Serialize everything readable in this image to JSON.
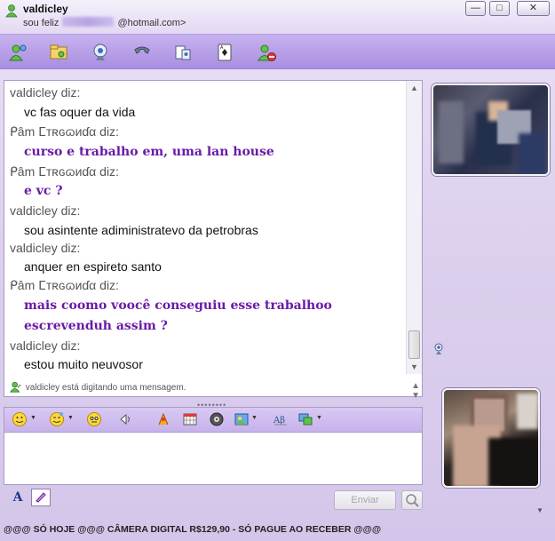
{
  "window": {
    "contact_name": "valdicley",
    "status_prefix": "sou feliz",
    "status_suffix": "@hotmail.com>",
    "minimize": "—",
    "maximize": "□",
    "close": "✕"
  },
  "toolbar": {
    "icons": [
      "invite-contact-icon",
      "send-files-icon",
      "webcam-icon",
      "call-icon",
      "video-call-icon",
      "games-icon",
      "block-icon"
    ]
  },
  "conversation": [
    {
      "sender": "valdicley diz:",
      "text": "vc fas oquer da vida",
      "type": "v"
    },
    {
      "sender": "ᑭâm ⵎтʀɢɷиɗα diz:",
      "text": "curso e trabalho em, uma lan house",
      "type": "p"
    },
    {
      "sender": "ᑭâm ⵎтʀɢɷиɗα diz:",
      "text": "e vc ?",
      "type": "p"
    },
    {
      "sender": "valdicley diz:",
      "text": "sou asintente adiministratevo da petrobras",
      "type": "v"
    },
    {
      "sender": "valdicley diz:",
      "text": "anquer en espireto santo",
      "type": "v"
    },
    {
      "sender": "ᑭâm ⵎтʀɢɷиɗα diz:",
      "text": "mais coomo voocê conseguiu esse trabalhoo",
      "text2": "escrevenduh assim ?",
      "type": "p"
    },
    {
      "sender": "valdicley diz:",
      "text": "estou muito neuvosor",
      "type": "v"
    }
  ],
  "typing_status": "valdicley está digitando uma mensagem.",
  "emote_bar": {
    "icons": [
      "smiley-icon",
      "wink-icon",
      "voice-clip-icon",
      "nudge-icon",
      "backgrounds-icon",
      "games-grid-icon",
      "music-icon",
      "photo-sharing-icon",
      "font-icon",
      "handwriting-icon"
    ]
  },
  "input": {
    "value": "",
    "send_label": "Enviar",
    "font_button": "A"
  },
  "ad": {
    "text": "@@@ SÓ HOJE @@@ CÂMERA DIGITAL R$129,90 - SÓ PAGUE AO RECEBER @@@"
  },
  "colors": {
    "accent": "#a98ee0",
    "partner_text": "#6a1aa6",
    "window_bg": "#dcd0ee"
  }
}
